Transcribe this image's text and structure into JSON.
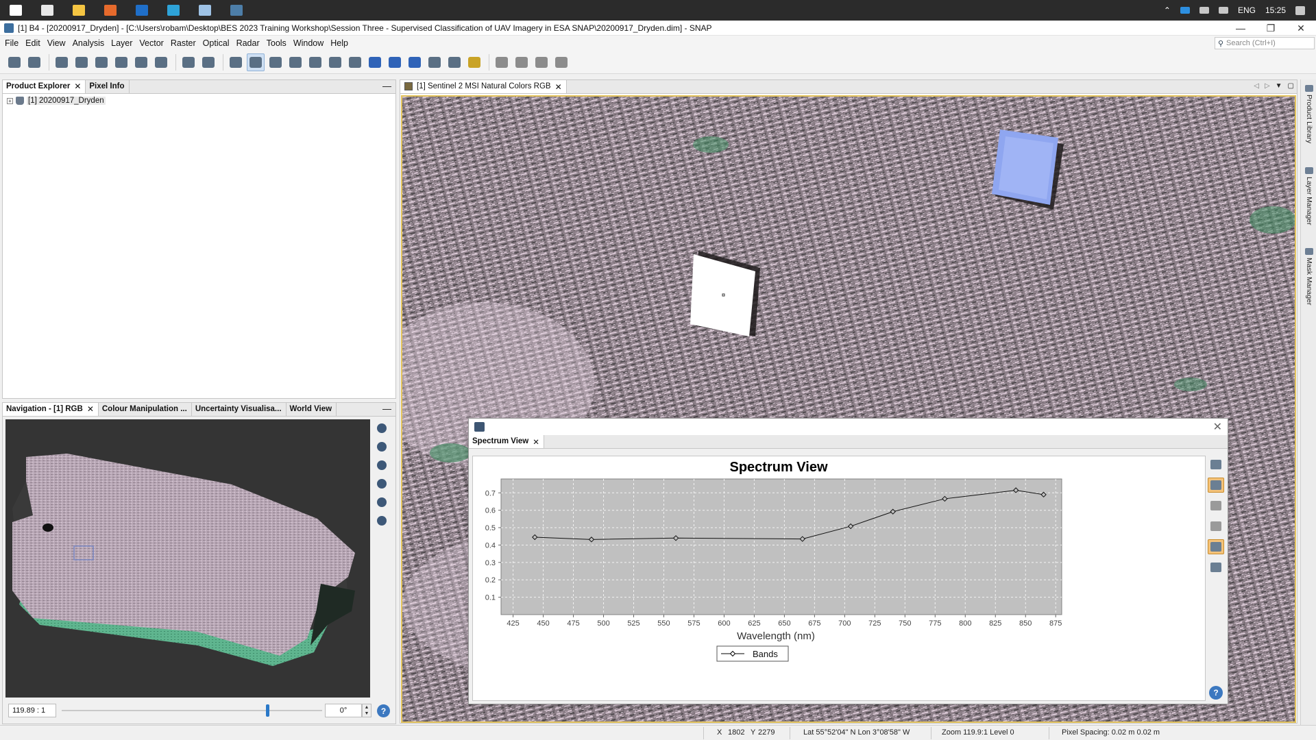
{
  "taskbar": {
    "apps": [
      {
        "name": "windows-start-icon",
        "color": "#ffffff"
      },
      {
        "name": "task-view-icon",
        "color": "#e8e8e8"
      },
      {
        "name": "file-explorer-icon",
        "color": "#f5c542"
      },
      {
        "name": "firefox-icon",
        "color": "#e66a2c"
      },
      {
        "name": "outlook-icon",
        "color": "#1f6fc9"
      },
      {
        "name": "edge-icon",
        "color": "#2ea3d8"
      },
      {
        "name": "notepad-icon",
        "color": "#9fc3e6"
      },
      {
        "name": "snap-icon",
        "color": "#4d7ea8"
      }
    ],
    "tray": {
      "language": "ENG",
      "time": "15:25"
    }
  },
  "window": {
    "title": "[1] B4 - [20200917_Dryden] - [C:\\Users\\robam\\Desktop\\BES 2023 Training Workshop\\Session Three - Supervised Classification of UAV Imagery in ESA SNAP\\20200917_Dryden.dim] - SNAP",
    "minimize": "—",
    "restore": "❐",
    "close": "✕"
  },
  "menu": {
    "items": [
      "File",
      "Edit",
      "View",
      "Analysis",
      "Layer",
      "Vector",
      "Raster",
      "Optical",
      "Radar",
      "Tools",
      "Window",
      "Help"
    ],
    "search_placeholder": "Search (Ctrl+I)"
  },
  "toolbar": {
    "groups": [
      [
        "open-product-icon",
        "save-product-icon"
      ],
      [
        "band-maths-icon",
        "graph-builder-icon",
        "grid-icon",
        "layer-icon",
        "gcp-icon",
        "mask-icon"
      ],
      [
        "graph-icon",
        "batch-icon"
      ],
      [
        "select-tool-icon",
        "pan-tool-icon",
        "zoom-tool-icon",
        "pin-tool-icon",
        "gcp-tool-icon",
        "line-tool-icon",
        "polyline-tool-icon",
        "rectangle-tool-icon",
        "polygon-tool-icon",
        "ellipse-tool-icon",
        "range-finder-icon",
        "magic-wand-icon",
        "measure-icon"
      ],
      [
        "tile-evenly-icon",
        "tile-horizontal-icon",
        "tile-vertical-icon",
        "tile-single-icon"
      ]
    ],
    "active": "pan-tool-icon"
  },
  "product_explorer": {
    "tabs": [
      "Product Explorer",
      "Pixel Info"
    ],
    "minimize": "—",
    "tree": [
      {
        "expander": "+",
        "label": "[1] 20200917_Dryden"
      }
    ]
  },
  "navigation": {
    "tabs": [
      "Navigation - [1] RGB",
      "Colour Manipulation ...",
      "Uncertainty Visualisa...",
      "World View"
    ],
    "minimize": "—",
    "zoom_value": "119.89 : 1",
    "rotation_value": "0°",
    "zoom_slider_fraction": 0.79,
    "tools": [
      "zoom-in-icon",
      "zoom-out-icon",
      "zoom-pixel-icon",
      "zoom-all-icon",
      "sync-views-icon",
      "sync-cursor-icon"
    ],
    "help": "?"
  },
  "image_view": {
    "tab": "[1] Sentinel 2 MSI Natural Colors RGB"
  },
  "spectrum": {
    "tab": "Spectrum View",
    "close": "✕",
    "tools": [
      "filter-bands-icon",
      "show-pixel-spectra-icon",
      "show-pin-spectra-icon",
      "show-selected-pins-icon",
      "show-grid-icon",
      "export-spectra-icon"
    ],
    "active_tools": [
      "show-pixel-spectra-icon",
      "show-grid-icon"
    ],
    "help": "?"
  },
  "chart_data": {
    "type": "line",
    "title": "Spectrum View",
    "xlabel": "Wavelength (nm)",
    "ylabel": "",
    "xlim": [
      415,
      880
    ],
    "ylim": [
      0,
      0.78
    ],
    "xticks": [
      425,
      450,
      475,
      500,
      525,
      550,
      575,
      600,
      625,
      650,
      675,
      700,
      725,
      750,
      775,
      800,
      825,
      850,
      875
    ],
    "yticks": [
      0.1,
      0.2,
      0.3,
      0.4,
      0.5,
      0.6,
      0.7
    ],
    "grid": true,
    "legend": "bottom-center",
    "series": [
      {
        "name": "Bands",
        "marker": "diamond",
        "x": [
          443,
          490,
          560,
          665,
          705,
          740,
          783,
          842,
          865
        ],
        "y": [
          0.445,
          0.432,
          0.44,
          0.435,
          0.508,
          0.592,
          0.666,
          0.715,
          0.69
        ]
      }
    ]
  },
  "statusbar": {
    "x_label": "X",
    "x_value": "1802",
    "y_label": "Y",
    "y_value": "2279",
    "latlon": "Lat 55°52'04\" N  Lon 3°08'58\" W",
    "zoom_level": "Zoom 119.9:1  Level 0",
    "pixel_spacing": "Pixel Spacing: 0.02 m 0.02 m"
  },
  "side_tabs": [
    "Product Library",
    "Layer Manager",
    "Mask Manager"
  ]
}
